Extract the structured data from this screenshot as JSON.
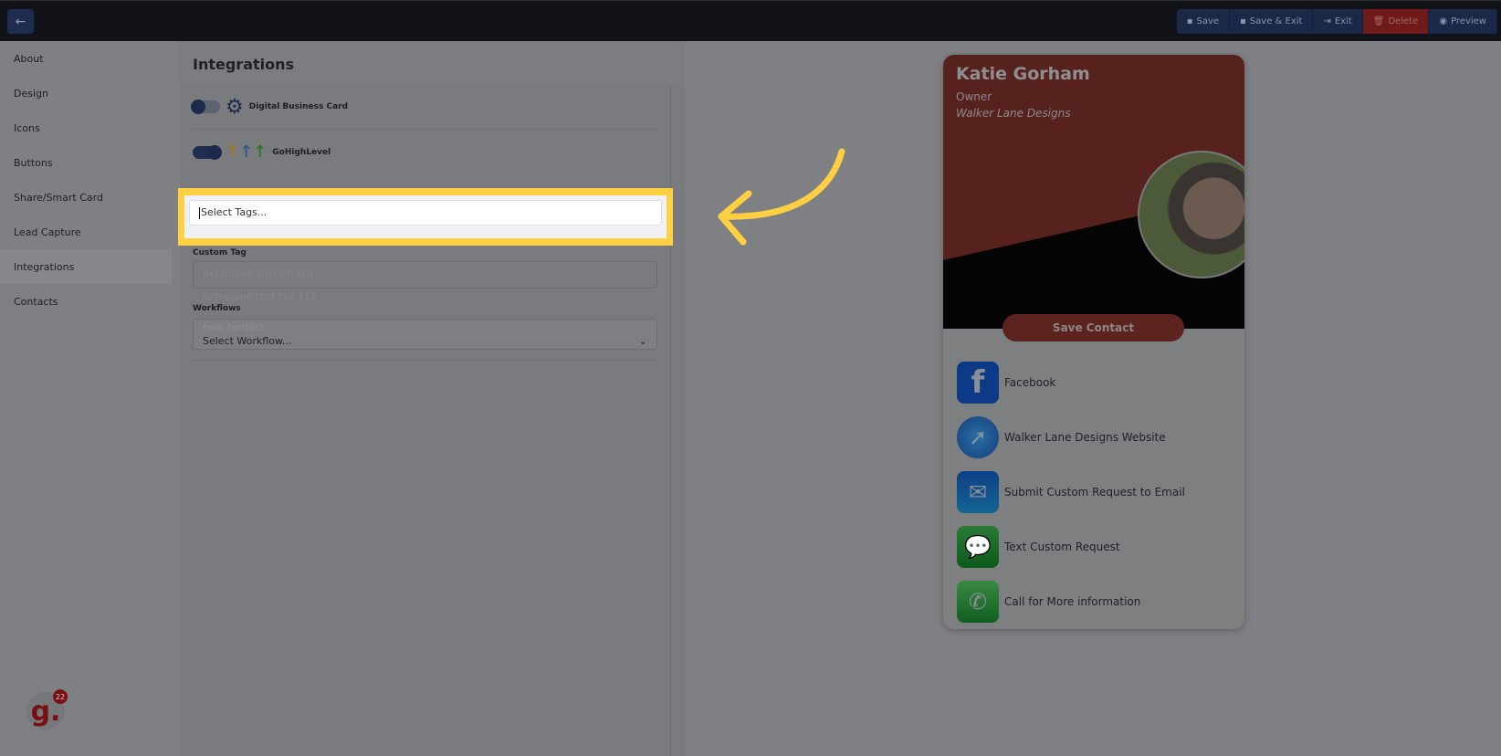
{
  "topbar": {
    "back_icon": "arrow-left-icon",
    "actions": [
      {
        "label": "Save",
        "icon": "floppy-icon"
      },
      {
        "label": "Save & Exit",
        "icon": "save-exit-icon"
      },
      {
        "label": "Exit",
        "icon": "exit-icon"
      },
      {
        "label": "Delete",
        "icon": "trash-icon",
        "color": "#6e1b1a"
      },
      {
        "label": "Preview",
        "icon": "eye-icon"
      }
    ]
  },
  "sidebar": {
    "items": [
      {
        "label": "About"
      },
      {
        "label": "Design"
      },
      {
        "label": "Icons"
      },
      {
        "label": "Buttons"
      },
      {
        "label": "Share/Smart Card"
      },
      {
        "label": "Lead Capture"
      },
      {
        "label": "Integrations",
        "active": true
      },
      {
        "label": "Contacts"
      }
    ]
  },
  "integrations": {
    "title": "Integrations",
    "items": [
      {
        "label": "Digital Business Card",
        "enabled": false
      },
      {
        "label": "GoHighLevel",
        "enabled": true
      }
    ],
    "tags_placeholder": "Select Tags...",
    "tag_options": [
      "netengine custom tag",
      "netengine test tag 111",
      "new contact"
    ],
    "custom_tag_label": "Custom Tag",
    "workflows_label": "Workflows",
    "workflow_value": "Select Workflow..."
  },
  "card": {
    "name": "Katie Gorham",
    "title": "Owner",
    "company": "Walker Lane Designs",
    "save_label": "Save Contact",
    "brand_color": "#8b3228",
    "links": [
      {
        "label": "Facebook",
        "icon": "facebook-icon"
      },
      {
        "label": "Walker Lane Designs Website",
        "icon": "safari-compass-icon"
      },
      {
        "label": "Submit Custom Request to Email",
        "icon": "mail-icon"
      },
      {
        "label": "Text Custom Request",
        "icon": "message-icon"
      },
      {
        "label": "Call for More information",
        "icon": "phone-icon"
      }
    ]
  },
  "badge": {
    "letter": "g.",
    "count": "22"
  },
  "highlight_color": "#ffd042"
}
